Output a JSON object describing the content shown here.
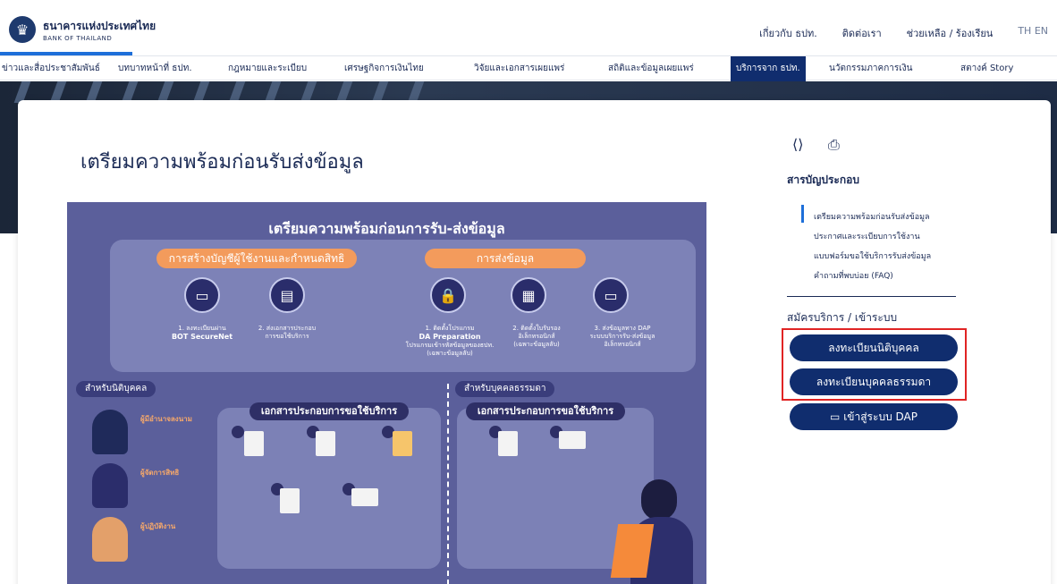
{
  "header": {
    "logo_th": "ธนาคารแห่งประเทศไทย",
    "logo_en": "BANK OF THAILAND",
    "links": [
      "เกี่ยวกับ ธปท.",
      "ติดต่อเรา",
      "ช่วยเหลือ / ร้องเรียน"
    ],
    "lang": "TH EN"
  },
  "nav": {
    "items": [
      "ข่าวและสื่อประชาสัมพันธ์",
      "บทบาทหน้าที่ ธปท.",
      "กฎหมายและระเบียบ",
      "เศรษฐกิจการเงินไทย",
      "วิจัยและเอกสารเผยแพร่",
      "สถิติและข้อมูลเผยแพร่",
      "บริการจาก ธปท.",
      "นวัตกรรมภาคการเงิน",
      "สตางค์ Story"
    ],
    "active_index": 6
  },
  "main": {
    "page_title": "เตรียมความพร้อมก่อนรับส่งข้อมูล"
  },
  "infographic": {
    "title": "เตรียมความพร้อมก่อนการรับ-ส่งข้อมูล",
    "pill_left": "การสร้างบัญชีผู้ใช้งานและกำหนดสิทธิ",
    "pill_right": "การส่งข้อมูล",
    "step1": "1. ลงทะเบียนผ่าน",
    "step1b": "BOT SecureNet",
    "step2": "2. ส่งเอกสารประกอบ",
    "step2b": "การขอใช้บริการ",
    "step3": "1. ติดตั้งโปรแกรม",
    "step3b": "DA Preparation",
    "step3c": "โปรแกรมเข้ารหัสข้อมูลของธปท. (เฉพาะข้อมูลลับ)",
    "step4": "2. ติดตั้งใบรับรอง",
    "step4b": "อิเล็กทรอนิกส์",
    "step4c": "(เฉพาะข้อมูลลับ)",
    "step5": "3. ส่งข้อมูลทาง DAP",
    "step5b": "ระบบบริการรับ-ส่งข้อมูล",
    "step5c": "อิเล็กทรอนิกส์",
    "tag_juristic": "สำหรับนิติบุคคล",
    "tag_person": "สำหรับบุคคลธรรมดา",
    "docs_pill": "เอกสารประกอบการขอใช้บริการ",
    "role1": "ผู้มีอำนาจลงนาม",
    "role2": "ผู้จัดการสิทธิ",
    "role3": "ผู้ปฏิบัติงาน"
  },
  "sidebar": {
    "toc_title": "สารบัญประกอบ",
    "toc_items": [
      "เตรียมความพร้อมก่อนรับส่งข้อมูล",
      "ประกาศและระเบียบการใช้งาน",
      "แบบฟอร์มขอใช้บริการรับส่งข้อมูล",
      "คำถามที่พบบ่อย (FAQ)"
    ],
    "register_title": "สมัครบริการ / เข้าระบบ",
    "btn_juristic": "ลงทะเบียนนิติบุคคล",
    "btn_person": "ลงทะเบียนบุคคลธรรมดา",
    "btn_dap": "เข้าสู่ระบบ DAP"
  }
}
